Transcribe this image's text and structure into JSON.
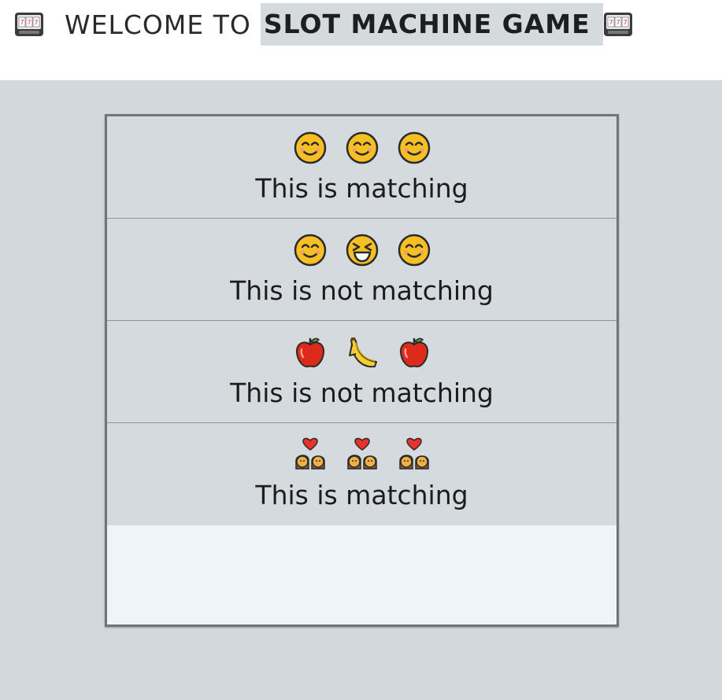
{
  "header": {
    "title_normal": "WELCOME TO",
    "title_bold": "SLOT MACHINE GAME",
    "icon": "slot-machine-icon"
  },
  "results": [
    {
      "symbols": [
        "smiling-face-icon",
        "smiling-face-icon",
        "smiling-face-icon"
      ],
      "status": "This is matching"
    },
    {
      "symbols": [
        "smiling-face-icon",
        "squinting-laughing-face-icon",
        "smiling-face-icon"
      ],
      "status": "This is not matching"
    },
    {
      "symbols": [
        "red-apple-icon",
        "banana-icon",
        "red-apple-icon"
      ],
      "status": "This is not matching"
    },
    {
      "symbols": [
        "couple-with-heart-icon",
        "couple-with-heart-icon",
        "couple-with-heart-icon"
      ],
      "status": "This is matching"
    }
  ],
  "colors": {
    "background": "#d2d8dc",
    "panel_border": "#6f7678",
    "row_background": "#d4dadd",
    "empty_area": "#eef4f8"
  }
}
